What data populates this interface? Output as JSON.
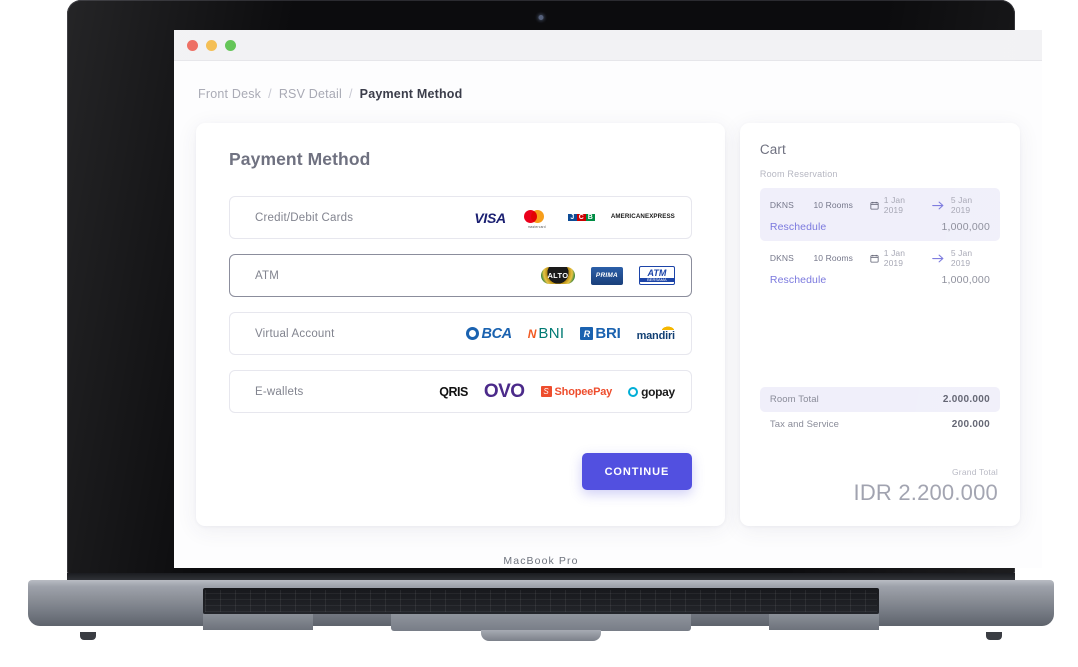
{
  "device": {
    "label": "MacBook Pro"
  },
  "window": {
    "dots": [
      "close",
      "minimize",
      "maximize"
    ]
  },
  "breadcrumb": {
    "items": [
      {
        "label": "Front Desk",
        "current": false
      },
      {
        "label": "RSV Detail",
        "current": false
      },
      {
        "label": "Payment Method",
        "current": true
      }
    ],
    "separator": "/"
  },
  "payment_panel": {
    "title": "Payment Method",
    "methods": [
      {
        "label": "Credit/Debit Cards",
        "selected": false,
        "logos": [
          "visa",
          "mastercard",
          "jcb",
          "american-express"
        ]
      },
      {
        "label": "ATM",
        "selected": true,
        "logos": [
          "alto",
          "prima",
          "atm-bersama"
        ]
      },
      {
        "label": "Virtual Account",
        "selected": false,
        "logos": [
          "bca",
          "bni",
          "bri",
          "mandiri"
        ]
      },
      {
        "label": "E-wallets",
        "selected": false,
        "logos": [
          "qris",
          "ovo",
          "shopeepay",
          "gopay"
        ]
      }
    ],
    "continue_label": "CONTINUE"
  },
  "logo_text": {
    "visa": "VISA",
    "mastercard": "mastercard",
    "jcb": [
      "J",
      "C",
      "B"
    ],
    "amex_line1": "AMERICAN",
    "amex_line2": "EXPRESS",
    "alto": "ALTO",
    "prima": "PRIMA",
    "atm_bersama_main": "ATM",
    "atm_bersama_sub": "BERSAMA",
    "bca": "BCA",
    "bni_mark": "N",
    "bni": "BNI",
    "bri_mark": "R",
    "bri": "BRI",
    "mandiri": "mandiri",
    "qris": "QRIS",
    "ovo": "OVO",
    "shopeepay_mark": "S",
    "shopeepay": "ShopeePay",
    "gopay": "gopay"
  },
  "cart": {
    "title": "Cart",
    "section_label": "Room Reservation",
    "items": [
      {
        "code": "DKNS",
        "rooms": "10 Rooms",
        "date_start": "1 Jan 2019",
        "date_end": "5 Jan 2019",
        "action_label": "Reschedule",
        "price": "1,000,000",
        "active": true
      },
      {
        "code": "DKNS",
        "rooms": "10 Rooms",
        "date_start": "1 Jan 2019",
        "date_end": "5 Jan 2019",
        "action_label": "Reschedule",
        "price": "1,000,000",
        "active": false
      }
    ],
    "totals": [
      {
        "label": "Room Total",
        "value": "2.000.000",
        "highlighted": true
      },
      {
        "label": "Tax and Service",
        "value": "200.000",
        "highlighted": false
      }
    ],
    "grand_total_label": "Grand Total",
    "grand_total_value": "IDR 2.200.000"
  },
  "colors": {
    "accent": "#5250e0",
    "link": "#7b79de",
    "highlight_row": "#f0effa",
    "page_bg": "#fdfdfe",
    "text_muted": "#a8a9b4"
  }
}
